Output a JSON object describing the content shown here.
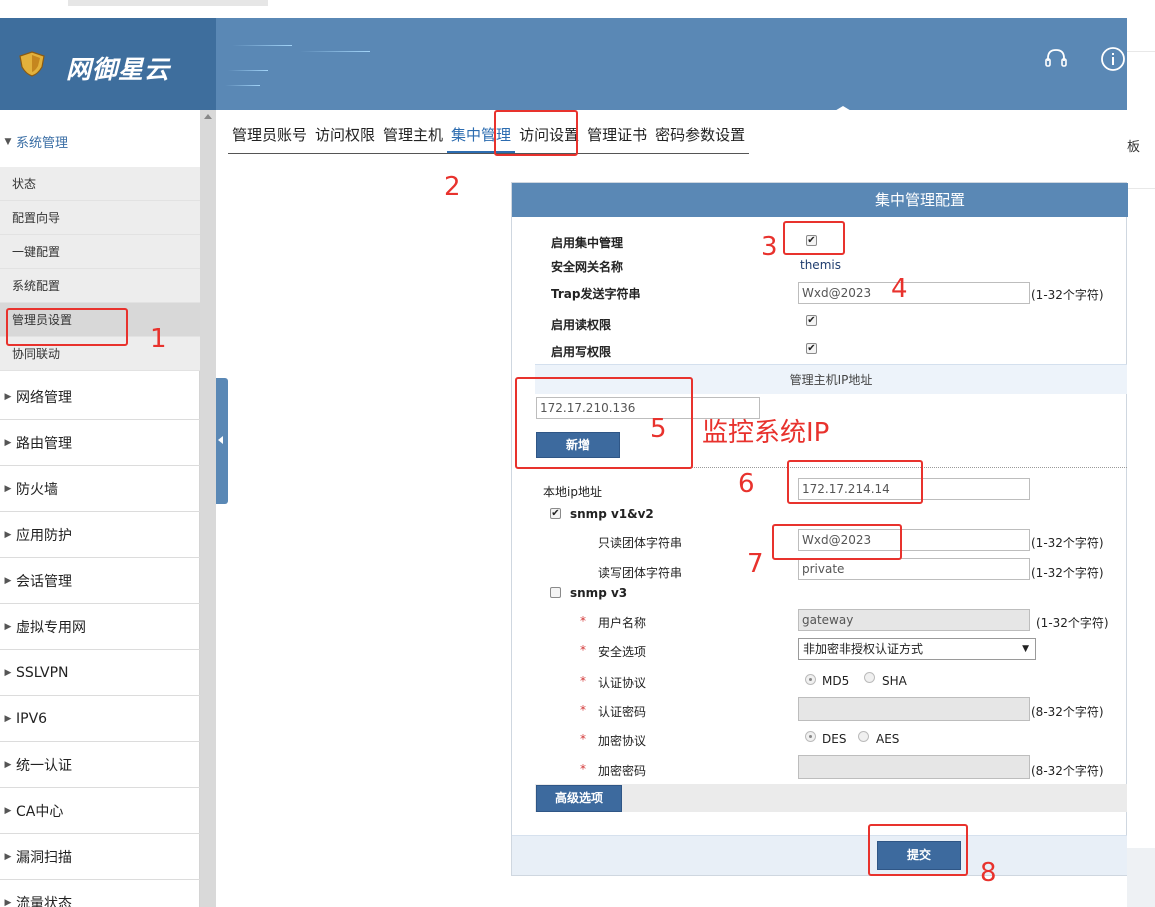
{
  "brand": {
    "logo_text": "网御星云"
  },
  "header": {
    "right_text": "板"
  },
  "sidebar": {
    "sections": [
      {
        "label": "系统管理",
        "open": true
      },
      {
        "label": "网络管理"
      },
      {
        "label": "路由管理"
      },
      {
        "label": "防火墙"
      },
      {
        "label": "应用防护"
      },
      {
        "label": "会话管理"
      },
      {
        "label": "虚拟专用网"
      },
      {
        "label": "SSLVPN"
      },
      {
        "label": "IPV6"
      },
      {
        "label": "统一认证"
      },
      {
        "label": "CA中心"
      },
      {
        "label": "漏洞扫描"
      },
      {
        "label": "流量状态"
      }
    ],
    "sub_items": [
      "状态",
      "配置向导",
      "一键配置",
      "系统配置",
      "管理员设置",
      "协同联动"
    ],
    "active_sub": "管理员设置"
  },
  "tabs": [
    "管理员账号",
    "访问权限",
    "管理主机",
    "集中管理",
    "访问设置",
    "管理证书",
    "密码参数设置"
  ],
  "active_tab": "集中管理",
  "form": {
    "title": "集中管理配置",
    "enable_label": "启用集中管理",
    "gateway_name_label": "安全网关名称",
    "gateway_name_value": "themis",
    "trap_label": "Trap发送字符串",
    "trap_value": "Wxd@2023",
    "hint_1_32": "(1-32个字符)",
    "hint_8_32": "(8-32个字符)",
    "read_perm_label": "启用读权限",
    "write_perm_label": "启用写权限",
    "check_mark": "✔",
    "host_ip_section": "管理主机IP地址",
    "host_ip_value": "172.17.210.136",
    "add_button": "新增",
    "local_ip_label": "本地ip地址",
    "local_ip_value": "172.17.214.14",
    "snmp_v12_label": "snmp v1&v2",
    "ro_community_label": "只读团体字符串",
    "ro_community_value": "Wxd@2023",
    "rw_community_label": "读写团体字符串",
    "rw_community_value": "private",
    "snmp_v3_label": "snmp v3",
    "required_mark": "*",
    "username_label": "用户名称",
    "username_value": "gateway",
    "security_label": "安全选项",
    "security_value": "非加密非授权认证方式",
    "dropdown_arrow": "▼",
    "auth_proto_label": "认证协议",
    "auth_md5": "MD5",
    "auth_sha": "SHA",
    "auth_pwd_label": "认证密码",
    "enc_proto_label": "加密协议",
    "enc_des": "DES",
    "enc_aes": "AES",
    "enc_pwd_label": "加密密码",
    "advanced_button": "高级选项",
    "submit_button": "提交"
  },
  "annotations": {
    "n1": "1",
    "n2": "2",
    "n3": "3",
    "n4": "4",
    "n5": "5",
    "n6": "6",
    "n7": "7",
    "n8": "8",
    "monitor_ip": "监控系统IP"
  },
  "colors": {
    "brand_blue": "#5a88b5",
    "annotation_red": "#e8322d"
  }
}
